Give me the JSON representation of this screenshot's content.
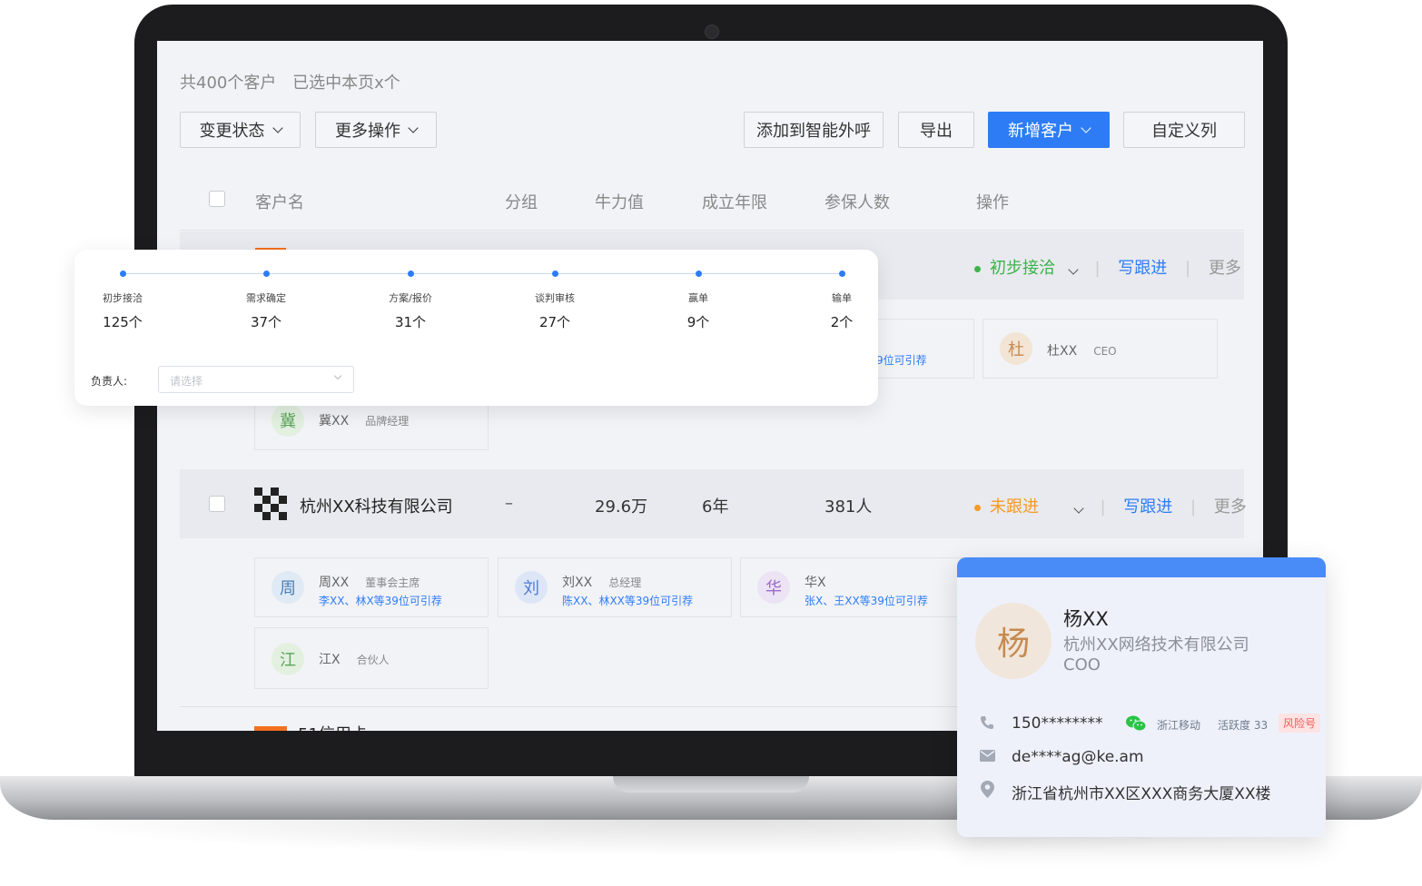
{
  "summary": {
    "total": "共400个客户",
    "selected": "已选中本页x个"
  },
  "toolbar": {
    "change_status": "变更状态",
    "more_actions": "更多操作",
    "add_call": "添加到智能外呼",
    "export": "导出",
    "add_customer": "新增客户",
    "custom_columns": "自定义列"
  },
  "columns": [
    "客户名",
    "分组",
    "牛力值",
    "成立年限",
    "参保人数",
    "操作"
  ],
  "rows": [
    {
      "status": "初步接洽",
      "status_color": "#3bb34a",
      "write_follow": "写跟进",
      "more": "更多",
      "contacts": [
        {
          "avatar": "杜",
          "name": "杜XX",
          "role": "CEO"
        },
        {
          "avatar": "冀",
          "name": "冀XX",
          "role": "品牌经理"
        }
      ],
      "partial_recommend": "9位可引荐"
    },
    {
      "name": "杭州XX科技有限公司",
      "group": "–",
      "value": "29.6万",
      "years": "6年",
      "insured": "381人",
      "status": "未跟进",
      "status_color": "#f59a23",
      "write_follow": "写跟进",
      "more": "更多",
      "contacts": [
        {
          "avatar": "周",
          "name": "周XX",
          "role": "董事会主席",
          "recommend": "李XX、林X等39位可引荐"
        },
        {
          "avatar": "刘",
          "name": "刘XX",
          "role": "总经理",
          "recommend": "陈XX、林XX等39位可引荐"
        },
        {
          "avatar": "华",
          "name": "华X",
          "role": "",
          "recommend": "张X、王XX等39位可引荐"
        },
        {
          "avatar": "江",
          "name": "江X",
          "role": "合伙人"
        }
      ]
    },
    {
      "name_partial": "51信用卡"
    }
  ],
  "funnel": {
    "stages": [
      {
        "label": "初步接洽",
        "count": "125个"
      },
      {
        "label": "需求确定",
        "count": "37个"
      },
      {
        "label": "方案/报价",
        "count": "31个"
      },
      {
        "label": "谈判审核",
        "count": "27个"
      },
      {
        "label": "赢单",
        "count": "9个"
      },
      {
        "label": "输单",
        "count": "2个"
      }
    ],
    "owner_label": "负责人:",
    "owner_placeholder": "请选择"
  },
  "contact_card": {
    "avatar": "杨",
    "name": "杨XX",
    "company": "杭州XX网络技术有限公司",
    "title": "COO",
    "phone": "150********",
    "carrier": "浙江移动",
    "activity": "活跃度 33",
    "risk_badge": "风险号",
    "email": "de****ag@ke.am",
    "address": "浙江省杭州市XX区XXX商务大厦XX楼"
  },
  "colors": {
    "primary": "#2d7cf6",
    "status_green": "#3bb34a",
    "status_orange": "#f59a23",
    "risk_red": "#f25a5a",
    "wechat_green": "#28c445"
  },
  "icons": [
    "chevron-down-icon",
    "company-logo-icon",
    "phone-icon",
    "wechat-icon",
    "mail-icon",
    "location-icon"
  ]
}
